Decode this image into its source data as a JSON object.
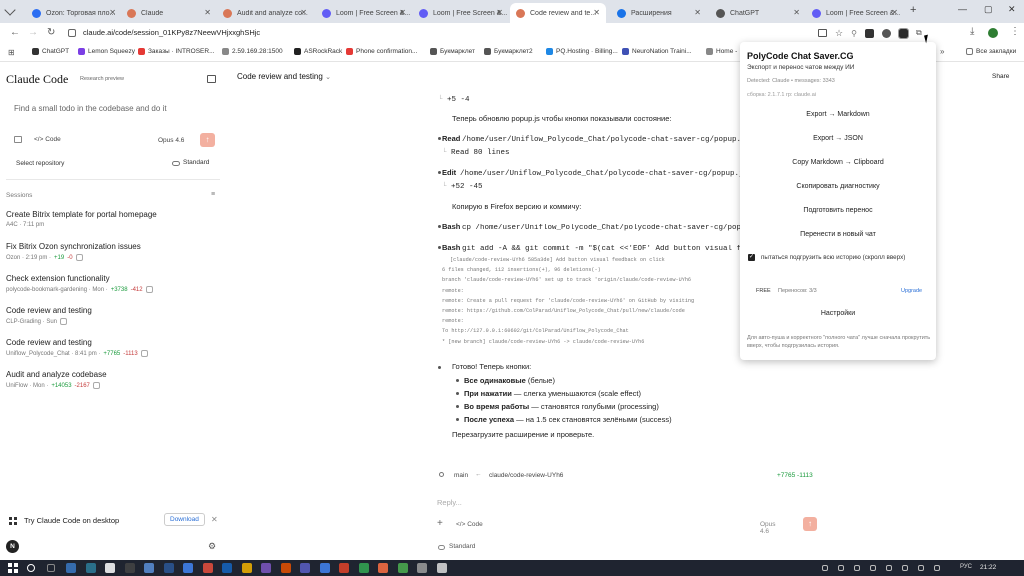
{
  "tabs": [
    {
      "label": "Ozon: Торговая пло...",
      "color": "#2c6ef2"
    },
    {
      "label": "Claude",
      "color": "#d97757"
    },
    {
      "label": "Audit and analyze co...",
      "color": "#d97757"
    },
    {
      "label": "Loom | Free Screen &...",
      "color": "#625df5"
    },
    {
      "label": "Loom | Free Screen &...",
      "color": "#625df5"
    },
    {
      "label": "Code review and te...",
      "color": "#d97757"
    },
    {
      "label": "Расширения",
      "color": "#1a73e8"
    },
    {
      "label": "ChatGPT",
      "color": "#555"
    },
    {
      "label": "Loom | Free Screen &...",
      "color": "#625df5"
    }
  ],
  "address": {
    "url": "claude.ai/code/session_01KPy8z7NeewVHjxxghSHjc"
  },
  "bookmarks": [
    "ChatGPT",
    "Lemon Squeezy",
    "Заказы · INTROSER...",
    "2.59.169.28:1500",
    "ASRockRack",
    "Phone confirmation...",
    "Букмарклет",
    "Букмарклет2",
    "PQ.Hosting · Billing...",
    "NeuroNation Traini...",
    "Home -"
  ],
  "bookmarks_folder": "Все закладки",
  "sidebar": {
    "brand": "Claude Code",
    "preview": "Research preview",
    "prompt_placeholder": "Find a small todo in the codebase and do it",
    "code_label": "Code",
    "model": "Opus 4.6",
    "select_repo": "Select repository",
    "standard": "Standard",
    "sessions_label": "Sessions",
    "sessions": [
      {
        "title": "Create Bitrix template for portal homepage",
        "meta": "A4C · 7:11 pm",
        "add": "",
        "del": ""
      },
      {
        "title": "Fix Bitrix Ozon synchronization issues",
        "meta": "Ozon · 2:19 pm ·",
        "add": "+19",
        "del": "-0"
      },
      {
        "title": "Check extension functionality",
        "meta": "polycode-bookmark-gardening · Mon ·",
        "add": "+3738",
        "del": "-412"
      },
      {
        "title": "Code review and testing",
        "meta": "CLP-Grading · Sun",
        "add": "",
        "del": ""
      },
      {
        "title": "Code review and testing",
        "meta": "Uniflow_Polycode_Chat · 8:41 pm ·",
        "add": "+7765",
        "del": "-1113"
      },
      {
        "title": "Audit and analyze codebase",
        "meta": "UniFlow · Mon ·",
        "add": "+14053",
        "del": "-2167"
      }
    ],
    "desktop_promo": "Try Claude Code on desktop",
    "download": "Download",
    "avatar": "N"
  },
  "main": {
    "title": "Code review and testing",
    "share": "Share",
    "lines": {
      "l1": "+5 -4",
      "l2": "Теперь обновлю popup.js чтобы кнопки показывали состояние:",
      "read": "Read",
      "read_path": "/home/user/Uniflow_Polycode_Chat/polycode-chat-saver-cg/popup.js",
      "read_res": "Read 80 lines",
      "edit": "Edit",
      "edit_path": "/home/user/Uniflow_Polycode_Chat/polycode-chat-saver-cg/popup.js",
      "edit_res": "+52 -45",
      "copy": "Копирую в Firefox версию и коммичу:",
      "bash1": "Bash",
      "bash1_cmd": "cp /home/user/Uniflow_Polycode_Chat/polycode-chat-saver-cg/popup.html /home/use",
      "bash2": "Bash",
      "bash2_cmd": "git add -A && git commit -m \"$(cat <<'EOF' Add button visual feedback on click",
      "out": [
        "[claude/code-review-UYh6 585a3de] Add button visual feedback on click",
        " 6 files changed, 112 insertions(+), 96 deletions(-)",
        "branch 'claude/code-review-UYh6' set up to track 'origin/claude/code-review-UYh6",
        "remote:",
        "remote: Create a pull request for 'claude/code-review-UYh6' on GitHub by visiting",
        "remote:     https://github.com/ColParad/Uniflow_Polycode_Chat/pull/new/claude/code",
        "remote:",
        "To http://127.0.0.1:60602/git/ColParad/Uniflow_Polycode_Chat",
        " * [new branch]      claude/code-review-UYh6 -> claude/code-review-UYh6"
      ],
      "done": "Готово! Теперь кнопки:",
      "b1a": "Все одинаковые",
      "b1b": " (белые)",
      "b2a": "При нажатии",
      "b2b": " — слегка уменьшаются (scale effect)",
      "b3a": "Во время работы",
      "b3b": " — становятся голубыми (processing)",
      "b4a": "После успеха",
      "b4b": " — на 1.5 сек становятся зелёными (success)",
      "reload": "Перезагрузите расширение и проверьте."
    },
    "branch_main": "main",
    "branch": "claude/code-review-UYh6",
    "diff": "+7765 -1113",
    "reply_placeholder": "Reply...",
    "code_label": "Code",
    "model": "Opus 4.6",
    "standard": "Standard"
  },
  "popup": {
    "title": "PolyCode Chat Saver.CG",
    "subtitle": "Экспорт и перенос чатов между ИИ",
    "detected": "Detected: Claude • messages: 3343",
    "build": "сборка: 2.1.7.1 rp: claude.ai",
    "buttons": [
      "Export → Markdown",
      "Export → JSON",
      "Copy Markdown → Clipboard",
      "Скопировать диагностику",
      "Подготовить перенос",
      "Перенести в новый чат"
    ],
    "checkbox": "пытаться подгрузить всю историю (скролл вверх)",
    "plan": "FREE",
    "transfers": "Переносов: 3/3",
    "upgrade": "Upgrade",
    "settings": "Настройки",
    "note": "Для авто-пуша и корректного \"полного чата\" лучше сначала прокрутить вверх, чтобы подгрузилась история."
  },
  "taskbar": {
    "lang": "РУС",
    "time": "21:22"
  }
}
